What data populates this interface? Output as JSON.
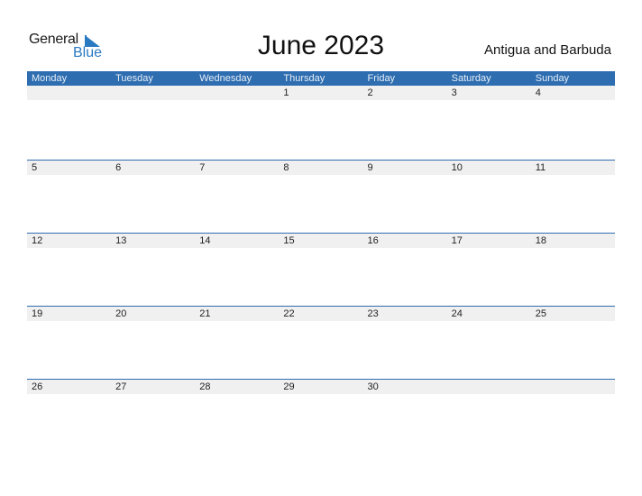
{
  "logo": {
    "general": "General",
    "blue": "Blue"
  },
  "title": "June 2023",
  "country": "Antigua and Barbuda",
  "days": [
    "Monday",
    "Tuesday",
    "Wednesday",
    "Thursday",
    "Friday",
    "Saturday",
    "Sunday"
  ],
  "weeks": [
    [
      "",
      "",
      "",
      "1",
      "2",
      "3",
      "4"
    ],
    [
      "5",
      "6",
      "7",
      "8",
      "9",
      "10",
      "11"
    ],
    [
      "12",
      "13",
      "14",
      "15",
      "16",
      "17",
      "18"
    ],
    [
      "19",
      "20",
      "21",
      "22",
      "23",
      "24",
      "25"
    ],
    [
      "26",
      "27",
      "28",
      "29",
      "30",
      "",
      ""
    ]
  ],
  "colors": {
    "accent": "#2e6db0",
    "row_bg": "#f0f0f0"
  }
}
